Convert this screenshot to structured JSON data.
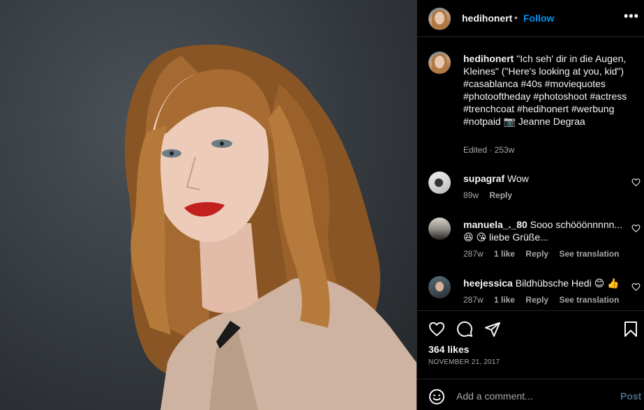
{
  "post": {
    "author": "hedihonert",
    "follow_label": "Follow",
    "separator": "•",
    "more_label": "•••"
  },
  "caption": {
    "username": "hedihonert",
    "text": "\"Ich seh' dir in die Augen, Kleines\" (\"Here's looking at you, kid\") #casablanca #40s #moviequotes #photooftheday #photoshoot #actress #trenchcoat #hedihonert #werbung #notpaid 📷 Jeanne Degraa",
    "edited": "Edited · 253w"
  },
  "comments": [
    {
      "username": "supagraf",
      "text": "Wow",
      "age": "89w",
      "likes": "",
      "reply": "Reply",
      "translate": ""
    },
    {
      "username": "manuela_._80",
      "text": "Sooo schööönnnnn... 😆 😘 liebe Grüße...",
      "age": "287w",
      "likes": "1 like",
      "reply": "Reply",
      "translate": "See translation"
    },
    {
      "username": "heejessica",
      "text": "Bildhübsche Hedi 😊 👍",
      "age": "287w",
      "likes": "1 like",
      "reply": "Reply",
      "translate": "See translation"
    }
  ],
  "actions": {
    "likes": "364 likes",
    "date": "NOVEMBER 21, 2017"
  },
  "add_comment": {
    "placeholder": "Add a comment...",
    "post_label": "Post"
  },
  "colors": {
    "background": "#000000",
    "link_blue": "#0095f6",
    "muted": "#a8a8a8",
    "post_disabled": "#4a6b86"
  },
  "icons": [
    "more-icon",
    "heart-icon",
    "comment-icon",
    "share-icon",
    "bookmark-icon",
    "emoji-icon",
    "heart-small-icon"
  ]
}
